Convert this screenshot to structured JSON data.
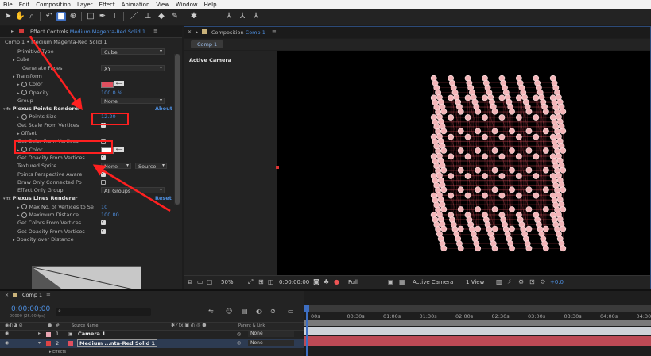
{
  "menubar": [
    "File",
    "Edit",
    "Composition",
    "Layer",
    "Effect",
    "Animation",
    "View",
    "Window",
    "Help"
  ],
  "effect_controls": {
    "tab_label": "Effect Controls",
    "tab_layer": "Medium Magenta-Red Solid 1",
    "path": "Comp 1 • Medium Magenta-Red Solid 1",
    "rows": [
      {
        "label": "Primitive Type",
        "value": "Cube",
        "kind": "dropdown",
        "indent": 22
      },
      {
        "label": "Cube",
        "kind": "group",
        "indent": 16
      },
      {
        "label": "Generate Faces",
        "value": "XY",
        "kind": "dropdown",
        "indent": 28
      },
      {
        "label": "Transform",
        "kind": "group",
        "indent": 16
      },
      {
        "label": "Color",
        "kind": "color",
        "indent": 22
      },
      {
        "label": "Opacity",
        "value": "100.0 %",
        "kind": "value",
        "indent": 22
      },
      {
        "label": "Group",
        "value": "None",
        "kind": "dropdown",
        "indent": 22
      },
      {
        "label": "Plexus Points Renderer",
        "kind": "fx",
        "about": "About",
        "indent": 4
      },
      {
        "label": "Points Size",
        "value": "12.20",
        "kind": "value",
        "indent": 22
      },
      {
        "label": "Get Scale From Vertices",
        "kind": "checkbox",
        "checked": true,
        "indent": 22
      },
      {
        "label": "Offset",
        "kind": "group",
        "indent": 22
      },
      {
        "label": "Get Color From Vertices",
        "kind": "checkbox",
        "checked": false,
        "indent": 22
      },
      {
        "label": "Color",
        "kind": "color",
        "indent": 22
      },
      {
        "label": "Get Opacity From Vertices",
        "kind": "checkbox",
        "checked": true,
        "indent": 22
      },
      {
        "label": "Textured Sprite",
        "value": "None",
        "value2": "Source",
        "kind": "dropdown2",
        "indent": 22
      },
      {
        "label": "Points Perspective Aware",
        "kind": "checkbox",
        "checked": true,
        "indent": 22
      },
      {
        "label": "Draw Only Connected Po",
        "kind": "checkbox",
        "checked": false,
        "indent": 22
      },
      {
        "label": "Effect Only Group",
        "value": "All Groups",
        "kind": "dropdown",
        "indent": 22
      },
      {
        "label": "Plexus Lines Renderer",
        "kind": "fx",
        "about": "Reset",
        "indent": 4
      },
      {
        "label": "Max No. of Vertices to Se",
        "value": "10",
        "kind": "value",
        "indent": 22
      },
      {
        "label": "Maximum Distance",
        "value": "100.00",
        "kind": "value",
        "indent": 22
      },
      {
        "label": "Get Colors From Vertices",
        "kind": "checkbox",
        "checked": true,
        "indent": 22
      },
      {
        "label": "Get Opacity From Vertices",
        "kind": "checkbox",
        "checked": true,
        "indent": 22
      },
      {
        "label": "Opacity over Distance",
        "kind": "group",
        "indent": 16
      }
    ]
  },
  "composition": {
    "tab_label": "Composition",
    "tab_comp": "Comp 1",
    "subtab": "Comp 1",
    "view_label": "Active Camera",
    "footer": {
      "zoom": "50%",
      "timecode": "0:00:00:00",
      "resolution": "Full",
      "camera": "Active Camera",
      "views": "1 View",
      "exposure": "+0.0"
    }
  },
  "timeline": {
    "tab": "Comp 1",
    "timecode": "0:00:00:00",
    "frame_info": "00000 (25.00 fps)",
    "search_placeholder": "",
    "col_source": "Source Name",
    "col_parent": "Parent & Link",
    "ruler": [
      "00s",
      "00:30s",
      "01:00s",
      "01:30s",
      "02:00s",
      "02:30s",
      "03:00s",
      "03:30s",
      "04:00s",
      "04:30s"
    ],
    "layers": [
      {
        "num": "1",
        "name": "Camera 1",
        "parent": "None"
      },
      {
        "num": "2",
        "name": "Medium ...nta-Red Solid 1",
        "parent": "None"
      }
    ],
    "effects_label": "Effects"
  },
  "colors": {
    "accent": "#3d6ec2",
    "link": "#4e8fe0",
    "annotation": "#ff2020",
    "cube_points": "#f3b5b8",
    "cube_lines": "#e0505f"
  }
}
